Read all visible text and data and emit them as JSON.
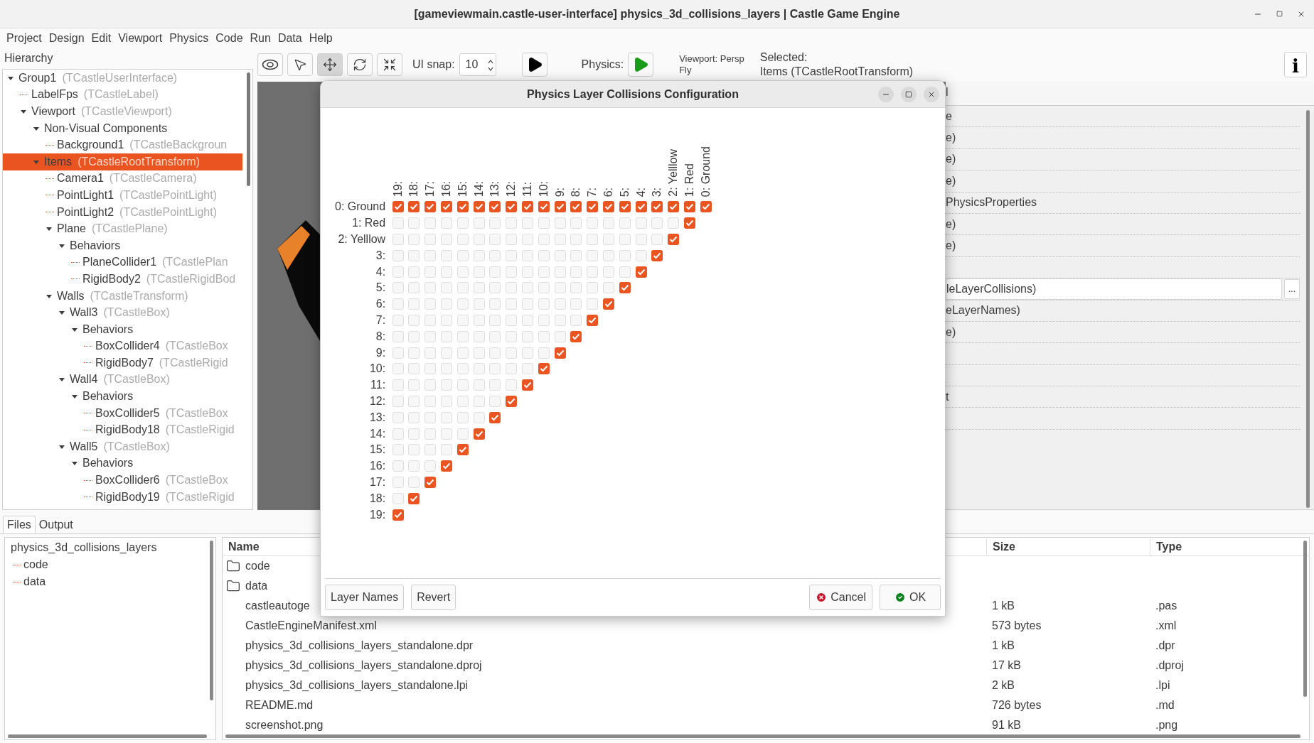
{
  "window": {
    "title": "[gameviewmain.castle-user-interface] physics_3d_collisions_layers | Castle Game Engine"
  },
  "menu": [
    "Project",
    "Design",
    "Edit",
    "Viewport",
    "Physics",
    "Code",
    "Run",
    "Data",
    "Help"
  ],
  "hierarchy": {
    "title": "Hierarchy",
    "items": [
      {
        "name": "Group1",
        "type": "(TCastleUserInterface)",
        "expanded": true,
        "selected": false,
        "children": [
          {
            "name": "LabelFps",
            "type": "(TCastleLabel)",
            "selected": false
          },
          {
            "name": "Viewport",
            "type": "(TCastleViewport)",
            "expanded": true,
            "selected": false,
            "children": [
              {
                "name": "Non-Visual Components",
                "expanded": true,
                "selected": false,
                "children": [
                  {
                    "name": "Background1",
                    "type": "(TCastleBackgroun",
                    "selected": false
                  }
                ]
              },
              {
                "name": "Items",
                "type": "(TCastleRootTransform)",
                "expanded": true,
                "selected": true,
                "children": [
                  {
                    "name": "Camera1",
                    "type": "(TCastleCamera)",
                    "selected": false
                  },
                  {
                    "name": "PointLight1",
                    "type": "(TCastlePointLight)",
                    "selected": false
                  },
                  {
                    "name": "PointLight2",
                    "type": "(TCastlePointLight)",
                    "selected": false
                  },
                  {
                    "name": "Plane",
                    "type": "(TCastlePlane)",
                    "expanded": true,
                    "selected": false,
                    "children": [
                      {
                        "name": "Behaviors",
                        "expanded": true,
                        "selected": false,
                        "children": [
                          {
                            "name": "PlaneCollider1",
                            "type": "(TCastlePlan",
                            "selected": false
                          },
                          {
                            "name": "RigidBody2",
                            "type": "(TCastleRigidBod",
                            "selected": false
                          }
                        ]
                      }
                    ]
                  },
                  {
                    "name": "Walls",
                    "type": "(TCastleTransform)",
                    "expanded": true,
                    "selected": false,
                    "children": [
                      {
                        "name": "Wall3",
                        "type": "(TCastleBox)",
                        "expanded": true,
                        "selected": false,
                        "children": [
                          {
                            "name": "Behaviors",
                            "expanded": true,
                            "selected": false,
                            "children": [
                              {
                                "name": "BoxCollider4",
                                "type": "(TCastleBox",
                                "selected": false
                              },
                              {
                                "name": "RigidBody7",
                                "type": "(TCastleRigid",
                                "selected": false
                              }
                            ]
                          }
                        ]
                      },
                      {
                        "name": "Wall4",
                        "type": "(TCastleBox)",
                        "expanded": true,
                        "selected": false,
                        "children": [
                          {
                            "name": "Behaviors",
                            "expanded": true,
                            "selected": false,
                            "children": [
                              {
                                "name": "BoxCollider5",
                                "type": "(TCastleBox",
                                "selected": false
                              },
                              {
                                "name": "RigidBody18",
                                "type": "(TCastleRigid",
                                "selected": false
                              }
                            ]
                          }
                        ]
                      },
                      {
                        "name": "Wall5",
                        "type": "(TCastleBox)",
                        "expanded": true,
                        "selected": false,
                        "children": [
                          {
                            "name": "Behaviors",
                            "expanded": true,
                            "selected": false,
                            "children": [
                              {
                                "name": "BoxCollider6",
                                "type": "(TCastleBox",
                                "selected": false
                              },
                              {
                                "name": "RigidBody19",
                                "type": "(TCastleRigid",
                                "selected": false
                              }
                            ]
                          }
                        ]
                      }
                    ]
                  }
                ]
              }
            ]
          }
        ]
      }
    ]
  },
  "toolbar": {
    "tools": [
      {
        "kind": "view",
        "selected": false
      },
      {
        "kind": "select",
        "selected": false
      },
      {
        "kind": "move",
        "selected": true
      },
      {
        "kind": "rotate",
        "selected": false
      },
      {
        "kind": "scale",
        "selected": false
      }
    ],
    "snap_label": "UI snap:",
    "snap_value": "10",
    "physics_label": "Physics:",
    "viewport_mode": "Viewport: Persp",
    "navigation": "Fly",
    "selected_label": "Selected:",
    "selected_value": "Items (TCastleRootTransform)",
    "info_button": "i"
  },
  "properties": {
    "tab_fragment": "l",
    "rows": [
      {
        "kind": "text",
        "value": "e"
      },
      {
        "kind": "text",
        "value": "e)"
      },
      {
        "kind": "text",
        "value": "e)"
      },
      {
        "kind": "text",
        "value": "e)"
      },
      {
        "kind": "text",
        "value": "PhysicsProperties"
      },
      {
        "kind": "text",
        "value": "e)"
      },
      {
        "kind": "text",
        "value": "e)"
      },
      {
        "kind": "empty"
      },
      {
        "kind": "field",
        "value": "leLayerCollisions)",
        "button": "..."
      },
      {
        "kind": "text",
        "value": "eLayerNames)"
      },
      {
        "kind": "text",
        "value": "e)"
      },
      {
        "kind": "empty"
      },
      {
        "kind": "empty"
      },
      {
        "kind": "text",
        "value": "t"
      },
      {
        "kind": "empty"
      }
    ]
  },
  "bottom": {
    "tabs": [
      {
        "label": "Files",
        "selected": true
      },
      {
        "label": "Output",
        "selected": false
      }
    ],
    "tree": {
      "name": "physics_3d_collisions_layers",
      "children": [
        "code",
        "data"
      ]
    },
    "columns": [
      "Name",
      "Size",
      "Type"
    ],
    "files": [
      {
        "kind": "folder",
        "name": "code"
      },
      {
        "kind": "folder",
        "name": "data"
      },
      {
        "kind": "file",
        "name": "castleautoge",
        "size": "1 kB",
        "type": ".pas"
      },
      {
        "kind": "file",
        "name": "CastleEngineManifest.xml",
        "size": "573 bytes",
        "type": ".xml"
      },
      {
        "kind": "file",
        "name": "physics_3d_collisions_layers_standalone.dpr",
        "size": "1 kB",
        "type": ".dpr"
      },
      {
        "kind": "file",
        "name": "physics_3d_collisions_layers_standalone.dproj",
        "size": "17 kB",
        "type": ".dproj"
      },
      {
        "kind": "file",
        "name": "physics_3d_collisions_layers_standalone.lpi",
        "size": "2 kB",
        "type": ".lpi"
      },
      {
        "kind": "file",
        "name": "README.md",
        "size": "726 bytes",
        "type": ".md"
      },
      {
        "kind": "file",
        "name": "screenshot.png",
        "size": "91 kB",
        "type": ".png"
      }
    ]
  },
  "dialog": {
    "title": "Physics Layer Collisions Configuration",
    "columns": [
      "19:",
      "18:",
      "17:",
      "16:",
      "15:",
      "14:",
      "13:",
      "12:",
      "11:",
      "10:",
      "9:",
      "8:",
      "7:",
      "6:",
      "5:",
      "4:",
      "3:",
      "2: Yelllow",
      "1: Red",
      "0: Ground"
    ],
    "rows": [
      {
        "label": "0: Ground",
        "cells": [
          true,
          true,
          true,
          true,
          true,
          true,
          true,
          true,
          true,
          true,
          true,
          true,
          true,
          true,
          true,
          true,
          true,
          true,
          true,
          true
        ]
      },
      {
        "label": "1: Red",
        "cells": [
          false,
          false,
          false,
          false,
          false,
          false,
          false,
          false,
          false,
          false,
          false,
          false,
          false,
          false,
          false,
          false,
          false,
          false,
          true
        ]
      },
      {
        "label": "2: Yelllow",
        "cells": [
          false,
          false,
          false,
          false,
          false,
          false,
          false,
          false,
          false,
          false,
          false,
          false,
          false,
          false,
          false,
          false,
          false,
          true
        ]
      },
      {
        "label": "3:",
        "cells": [
          false,
          false,
          false,
          false,
          false,
          false,
          false,
          false,
          false,
          false,
          false,
          false,
          false,
          false,
          false,
          false,
          true
        ]
      },
      {
        "label": "4:",
        "cells": [
          false,
          false,
          false,
          false,
          false,
          false,
          false,
          false,
          false,
          false,
          false,
          false,
          false,
          false,
          false,
          true
        ]
      },
      {
        "label": "5:",
        "cells": [
          false,
          false,
          false,
          false,
          false,
          false,
          false,
          false,
          false,
          false,
          false,
          false,
          false,
          false,
          true
        ]
      },
      {
        "label": "6:",
        "cells": [
          false,
          false,
          false,
          false,
          false,
          false,
          false,
          false,
          false,
          false,
          false,
          false,
          false,
          true
        ]
      },
      {
        "label": "7:",
        "cells": [
          false,
          false,
          false,
          false,
          false,
          false,
          false,
          false,
          false,
          false,
          false,
          false,
          true
        ]
      },
      {
        "label": "8:",
        "cells": [
          false,
          false,
          false,
          false,
          false,
          false,
          false,
          false,
          false,
          false,
          false,
          true
        ]
      },
      {
        "label": "9:",
        "cells": [
          false,
          false,
          false,
          false,
          false,
          false,
          false,
          false,
          false,
          false,
          true
        ]
      },
      {
        "label": "10:",
        "cells": [
          false,
          false,
          false,
          false,
          false,
          false,
          false,
          false,
          false,
          true
        ]
      },
      {
        "label": "11:",
        "cells": [
          false,
          false,
          false,
          false,
          false,
          false,
          false,
          false,
          true
        ]
      },
      {
        "label": "12:",
        "cells": [
          false,
          false,
          false,
          false,
          false,
          false,
          false,
          true
        ]
      },
      {
        "label": "13:",
        "cells": [
          false,
          false,
          false,
          false,
          false,
          false,
          true
        ]
      },
      {
        "label": "14:",
        "cells": [
          false,
          false,
          false,
          false,
          false,
          true
        ]
      },
      {
        "label": "15:",
        "cells": [
          false,
          false,
          false,
          false,
          true
        ]
      },
      {
        "label": "16:",
        "cells": [
          false,
          false,
          false,
          true
        ]
      },
      {
        "label": "17:",
        "cells": [
          false,
          false,
          true
        ]
      },
      {
        "label": "18:",
        "cells": [
          false,
          true
        ]
      },
      {
        "label": "19:",
        "cells": [
          true
        ]
      }
    ],
    "left_buttons": [
      "Layer Names",
      "Revert"
    ],
    "right_buttons": [
      {
        "kind": "cancel",
        "label": "Cancel"
      },
      {
        "kind": "ok",
        "label": "OK"
      }
    ]
  }
}
